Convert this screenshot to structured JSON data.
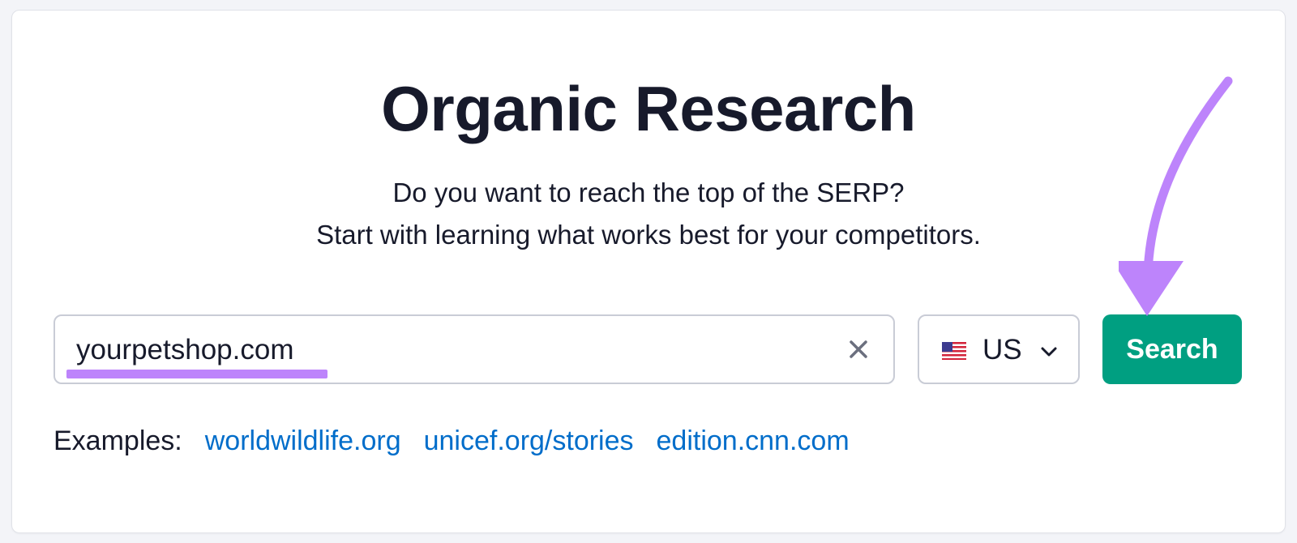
{
  "page": {
    "title": "Organic Research",
    "subtitle_line1": "Do you want to reach the top of the SERP?",
    "subtitle_line2": "Start with learning what works best for your competitors."
  },
  "search": {
    "value": "yourpetshop.com",
    "clear_icon": "close-icon"
  },
  "country": {
    "code": "US",
    "flag_icon": "us-flag-icon",
    "dropdown_icon": "chevron-down-icon"
  },
  "search_button": {
    "label": "Search"
  },
  "examples": {
    "label": "Examples:",
    "links": [
      "worldwildlife.org",
      "unicef.org/stories",
      "edition.cnn.com"
    ]
  },
  "annotations": {
    "highlight_color": "#bd84fb",
    "arrow_color": "#bd84fb"
  },
  "colors": {
    "primary_button": "#009f81",
    "link": "#006dca",
    "text": "#171a2b"
  }
}
